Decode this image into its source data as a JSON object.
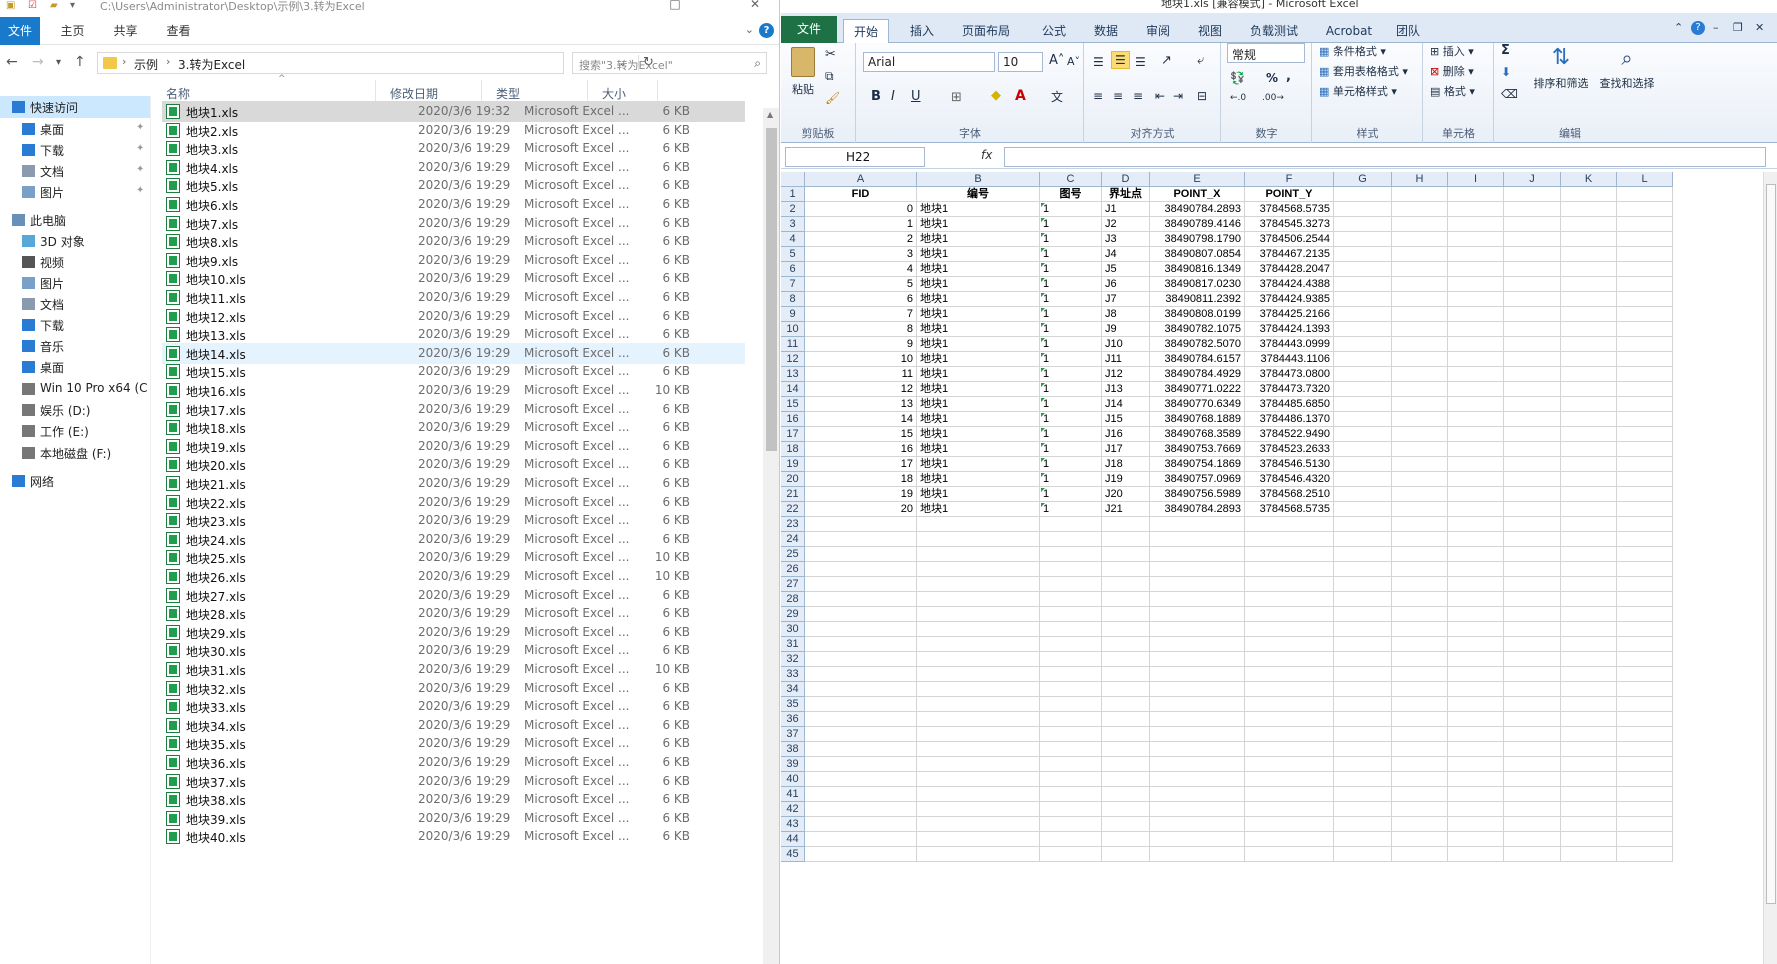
{
  "explorer": {
    "path": "C:\\Users\\Administrator\\Desktop\\示例\\3.转为Excel",
    "ribbon_tabs": [
      "文件",
      "主页",
      "共享",
      "查看"
    ],
    "help": "?",
    "breadcrumbs": [
      "示例",
      "3.转为Excel"
    ],
    "search_placeholder": "搜索\"3.转为Excel\"",
    "nav": [
      {
        "label": "快速访问",
        "icon": "star-icon",
        "pinned": false
      },
      {
        "label": "桌面",
        "icon": "desktop-icon",
        "pinned": true
      },
      {
        "label": "下载",
        "icon": "download-icon",
        "pinned": true
      },
      {
        "label": "文档",
        "icon": "document-icon",
        "pinned": true
      },
      {
        "label": "图片",
        "icon": "picture-icon",
        "pinned": true
      },
      {
        "label": "此电脑",
        "icon": "computer-icon",
        "pinned": false
      },
      {
        "label": "3D 对象",
        "icon": "cube-icon",
        "pinned": false
      },
      {
        "label": "视频",
        "icon": "video-icon",
        "pinned": false
      },
      {
        "label": "图片",
        "icon": "picture-icon",
        "pinned": false
      },
      {
        "label": "文档",
        "icon": "document-icon",
        "pinned": false
      },
      {
        "label": "下载",
        "icon": "download-icon",
        "pinned": false
      },
      {
        "label": "音乐",
        "icon": "music-icon",
        "pinned": false
      },
      {
        "label": "桌面",
        "icon": "desktop-icon",
        "pinned": false
      },
      {
        "label": "Win 10 Pro x64 (C",
        "icon": "drive-icon",
        "pinned": false
      },
      {
        "label": "娱乐 (D:)",
        "icon": "drive-icon",
        "pinned": false
      },
      {
        "label": "工作 (E:)",
        "icon": "drive-icon",
        "pinned": false
      },
      {
        "label": "本地磁盘 (F:)",
        "icon": "drive-icon",
        "pinned": false
      },
      {
        "label": "网络",
        "icon": "network-icon",
        "pinned": false
      }
    ],
    "columns": [
      "名称",
      "修改日期",
      "类型",
      "大小"
    ],
    "files": [
      {
        "name": "地块1.xls",
        "date": "2020/3/6 19:32",
        "type": "Microsoft Excel ...",
        "size": "6 KB"
      },
      {
        "name": "地块2.xls",
        "date": "2020/3/6 19:29",
        "type": "Microsoft Excel ...",
        "size": "6 KB"
      },
      {
        "name": "地块3.xls",
        "date": "2020/3/6 19:29",
        "type": "Microsoft Excel ...",
        "size": "6 KB"
      },
      {
        "name": "地块4.xls",
        "date": "2020/3/6 19:29",
        "type": "Microsoft Excel ...",
        "size": "6 KB"
      },
      {
        "name": "地块5.xls",
        "date": "2020/3/6 19:29",
        "type": "Microsoft Excel ...",
        "size": "6 KB"
      },
      {
        "name": "地块6.xls",
        "date": "2020/3/6 19:29",
        "type": "Microsoft Excel ...",
        "size": "6 KB"
      },
      {
        "name": "地块7.xls",
        "date": "2020/3/6 19:29",
        "type": "Microsoft Excel ...",
        "size": "6 KB"
      },
      {
        "name": "地块8.xls",
        "date": "2020/3/6 19:29",
        "type": "Microsoft Excel ...",
        "size": "6 KB"
      },
      {
        "name": "地块9.xls",
        "date": "2020/3/6 19:29",
        "type": "Microsoft Excel ...",
        "size": "6 KB"
      },
      {
        "name": "地块10.xls",
        "date": "2020/3/6 19:29",
        "type": "Microsoft Excel ...",
        "size": "6 KB"
      },
      {
        "name": "地块11.xls",
        "date": "2020/3/6 19:29",
        "type": "Microsoft Excel ...",
        "size": "6 KB"
      },
      {
        "name": "地块12.xls",
        "date": "2020/3/6 19:29",
        "type": "Microsoft Excel ...",
        "size": "6 KB"
      },
      {
        "name": "地块13.xls",
        "date": "2020/3/6 19:29",
        "type": "Microsoft Excel ...",
        "size": "6 KB"
      },
      {
        "name": "地块14.xls",
        "date": "2020/3/6 19:29",
        "type": "Microsoft Excel ...",
        "size": "6 KB"
      },
      {
        "name": "地块15.xls",
        "date": "2020/3/6 19:29",
        "type": "Microsoft Excel ...",
        "size": "6 KB"
      },
      {
        "name": "地块16.xls",
        "date": "2020/3/6 19:29",
        "type": "Microsoft Excel ...",
        "size": "10 KB"
      },
      {
        "name": "地块17.xls",
        "date": "2020/3/6 19:29",
        "type": "Microsoft Excel ...",
        "size": "6 KB"
      },
      {
        "name": "地块18.xls",
        "date": "2020/3/6 19:29",
        "type": "Microsoft Excel ...",
        "size": "6 KB"
      },
      {
        "name": "地块19.xls",
        "date": "2020/3/6 19:29",
        "type": "Microsoft Excel ...",
        "size": "6 KB"
      },
      {
        "name": "地块20.xls",
        "date": "2020/3/6 19:29",
        "type": "Microsoft Excel ...",
        "size": "6 KB"
      },
      {
        "name": "地块21.xls",
        "date": "2020/3/6 19:29",
        "type": "Microsoft Excel ...",
        "size": "6 KB"
      },
      {
        "name": "地块22.xls",
        "date": "2020/3/6 19:29",
        "type": "Microsoft Excel ...",
        "size": "6 KB"
      },
      {
        "name": "地块23.xls",
        "date": "2020/3/6 19:29",
        "type": "Microsoft Excel ...",
        "size": "6 KB"
      },
      {
        "name": "地块24.xls",
        "date": "2020/3/6 19:29",
        "type": "Microsoft Excel ...",
        "size": "6 KB"
      },
      {
        "name": "地块25.xls",
        "date": "2020/3/6 19:29",
        "type": "Microsoft Excel ...",
        "size": "10 KB"
      },
      {
        "name": "地块26.xls",
        "date": "2020/3/6 19:29",
        "type": "Microsoft Excel ...",
        "size": "10 KB"
      },
      {
        "name": "地块27.xls",
        "date": "2020/3/6 19:29",
        "type": "Microsoft Excel ...",
        "size": "6 KB"
      },
      {
        "name": "地块28.xls",
        "date": "2020/3/6 19:29",
        "type": "Microsoft Excel ...",
        "size": "6 KB"
      },
      {
        "name": "地块29.xls",
        "date": "2020/3/6 19:29",
        "type": "Microsoft Excel ...",
        "size": "6 KB"
      },
      {
        "name": "地块30.xls",
        "date": "2020/3/6 19:29",
        "type": "Microsoft Excel ...",
        "size": "6 KB"
      },
      {
        "name": "地块31.xls",
        "date": "2020/3/6 19:29",
        "type": "Microsoft Excel ...",
        "size": "10 KB"
      },
      {
        "name": "地块32.xls",
        "date": "2020/3/6 19:29",
        "type": "Microsoft Excel ...",
        "size": "6 KB"
      },
      {
        "name": "地块33.xls",
        "date": "2020/3/6 19:29",
        "type": "Microsoft Excel ...",
        "size": "6 KB"
      },
      {
        "name": "地块34.xls",
        "date": "2020/3/6 19:29",
        "type": "Microsoft Excel ...",
        "size": "6 KB"
      },
      {
        "name": "地块35.xls",
        "date": "2020/3/6 19:29",
        "type": "Microsoft Excel ...",
        "size": "6 KB"
      },
      {
        "name": "地块36.xls",
        "date": "2020/3/6 19:29",
        "type": "Microsoft Excel ...",
        "size": "6 KB"
      },
      {
        "name": "地块37.xls",
        "date": "2020/3/6 19:29",
        "type": "Microsoft Excel ...",
        "size": "6 KB"
      },
      {
        "name": "地块38.xls",
        "date": "2020/3/6 19:29",
        "type": "Microsoft Excel ...",
        "size": "6 KB"
      },
      {
        "name": "地块39.xls",
        "date": "2020/3/6 19:29",
        "type": "Microsoft Excel ...",
        "size": "6 KB"
      },
      {
        "name": "地块40.xls",
        "date": "2020/3/6 19:29",
        "type": "Microsoft Excel ...",
        "size": "6 KB"
      }
    ]
  },
  "excel": {
    "title": "地块1.xls [兼容模式] - Microsoft Excel",
    "tabs": [
      "文件",
      "开始",
      "插入",
      "页面布局",
      "公式",
      "数据",
      "审阅",
      "视图",
      "负载测试",
      "Acrobat",
      "团队"
    ],
    "font_name": "Arial",
    "font_size": "10",
    "number_format": "常规",
    "groups": {
      "clipboard": "剪贴板",
      "font": "字体",
      "align": "对齐方式",
      "number": "数字",
      "style": "样式",
      "cells": "单元格",
      "edit": "编辑"
    },
    "buttons": {
      "paste": "粘贴",
      "bold": "B",
      "italic": "I",
      "underline": "U",
      "cond_format": "条件格式",
      "table_format": "套用表格格式",
      "cell_style": "单元格样式",
      "insert": "插入",
      "delete": "删除",
      "format": "格式",
      "sum": "Σ",
      "sort_filter": "排序和筛选",
      "find_select": "查找和选择",
      "percent": "%",
      "comma": ","
    },
    "name_box": "H22",
    "fx": "fx",
    "col_letters": [
      "A",
      "B",
      "C",
      "D",
      "E",
      "F",
      "G",
      "H",
      "I",
      "J",
      "K",
      "L"
    ],
    "header": [
      "FID",
      "编号",
      "图号",
      "界址点",
      "POINT_X",
      "POINT_Y"
    ],
    "rows": [
      [
        "0",
        "地块1",
        "1",
        "J1",
        "38490784.2893",
        "3784568.5735"
      ],
      [
        "1",
        "地块1",
        "1",
        "J2",
        "38490789.4146",
        "3784545.3273"
      ],
      [
        "2",
        "地块1",
        "1",
        "J3",
        "38490798.1790",
        "3784506.2544"
      ],
      [
        "3",
        "地块1",
        "1",
        "J4",
        "38490807.0854",
        "3784467.2135"
      ],
      [
        "4",
        "地块1",
        "1",
        "J5",
        "38490816.1349",
        "3784428.2047"
      ],
      [
        "5",
        "地块1",
        "1",
        "J6",
        "38490817.0230",
        "3784424.4388"
      ],
      [
        "6",
        "地块1",
        "1",
        "J7",
        "38490811.2392",
        "3784424.9385"
      ],
      [
        "7",
        "地块1",
        "1",
        "J8",
        "38490808.0199",
        "3784425.2166"
      ],
      [
        "8",
        "地块1",
        "1",
        "J9",
        "38490782.1075",
        "3784424.1393"
      ],
      [
        "9",
        "地块1",
        "1",
        "J10",
        "38490782.5070",
        "3784443.0999"
      ],
      [
        "10",
        "地块1",
        "1",
        "J11",
        "38490784.6157",
        "3784443.1106"
      ],
      [
        "11",
        "地块1",
        "1",
        "J12",
        "38490784.4929",
        "3784473.0800"
      ],
      [
        "12",
        "地块1",
        "1",
        "J13",
        "38490771.0222",
        "3784473.7320"
      ],
      [
        "13",
        "地块1",
        "1",
        "J14",
        "38490770.6349",
        "3784485.6850"
      ],
      [
        "14",
        "地块1",
        "1",
        "J15",
        "38490768.1889",
        "3784486.1370"
      ],
      [
        "15",
        "地块1",
        "1",
        "J16",
        "38490768.3589",
        "3784522.9490"
      ],
      [
        "16",
        "地块1",
        "1",
        "J17",
        "38490753.7669",
        "3784523.2633"
      ],
      [
        "17",
        "地块1",
        "1",
        "J18",
        "38490754.1869",
        "3784546.5130"
      ],
      [
        "18",
        "地块1",
        "1",
        "J19",
        "38490757.0969",
        "3784546.4320"
      ],
      [
        "19",
        "地块1",
        "1",
        "J20",
        "38490756.5989",
        "3784568.2510"
      ],
      [
        "20",
        "地块1",
        "1",
        "J21",
        "38490784.2893",
        "3784568.5735"
      ]
    ],
    "visible_rows": 45
  }
}
